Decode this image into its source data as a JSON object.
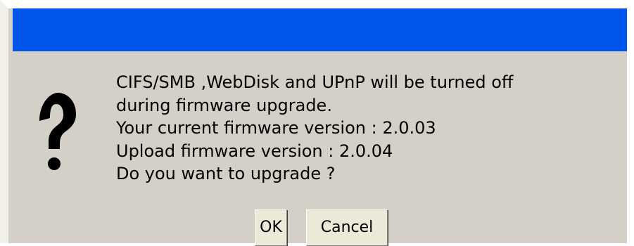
{
  "dialog": {
    "icon": "question-icon",
    "message_lines": [
      "CIFS/SMB ,WebDisk and UPnP will be turned off",
      "during firmware upgrade.",
      "Your current firmware version : 2.0.03",
      "Upload firmware version : 2.0.04",
      "Do you want to upgrade ?"
    ],
    "ok_label": "OK",
    "cancel_label": "Cancel"
  },
  "colors": {
    "titlebar": "#0055ea",
    "background": "#d4d0c8"
  }
}
